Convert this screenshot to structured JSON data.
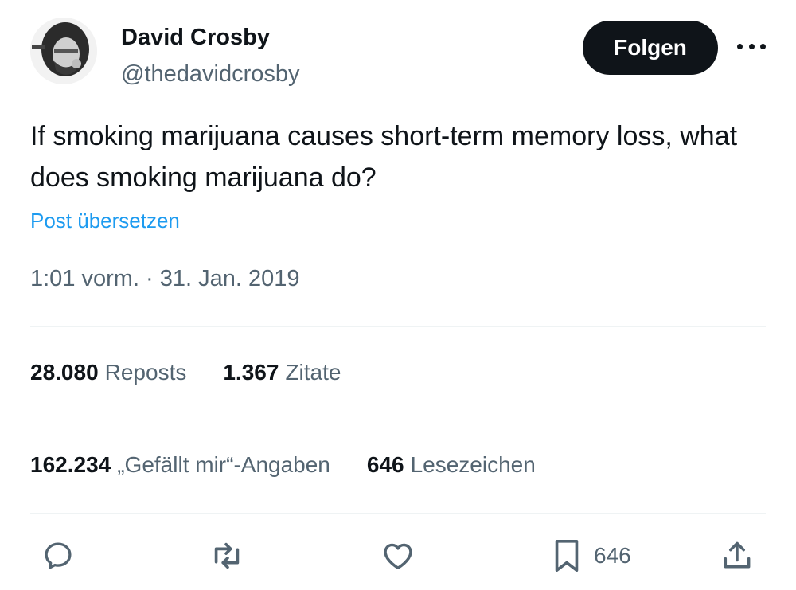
{
  "author": {
    "display_name": "David Crosby",
    "handle": "@thedavidcrosby",
    "avatar_icon": "profile-photo"
  },
  "follow_label": "Folgen",
  "more_icon": "more-horizontal-icon",
  "tweet": {
    "text": "If smoking marijuana causes short-term memory loss, what does smoking marijuana do?",
    "translate_label": "Post übersetzen",
    "timestamp": "1:01 vorm. · 31. Jan. 2019"
  },
  "stats": {
    "reposts": {
      "value": "28.080",
      "label": "Reposts"
    },
    "quotes": {
      "value": "1.367",
      "label": "Zitate"
    },
    "likes": {
      "value": "162.234",
      "label": "„Gefällt mir“-Angaben"
    },
    "bookmarks": {
      "value": "646",
      "label": "Lesezeichen"
    }
  },
  "actions": {
    "reply_icon": "reply-icon",
    "repost_icon": "repost-icon",
    "like_icon": "heart-icon",
    "bookmark_icon": "bookmark-icon",
    "bookmark_count": "646",
    "share_icon": "share-icon"
  },
  "colors": {
    "text": "#0f1419",
    "secondary": "#536471",
    "link": "#1d9bf0",
    "divider": "#eff3f4",
    "button_bg": "#0f1419"
  }
}
